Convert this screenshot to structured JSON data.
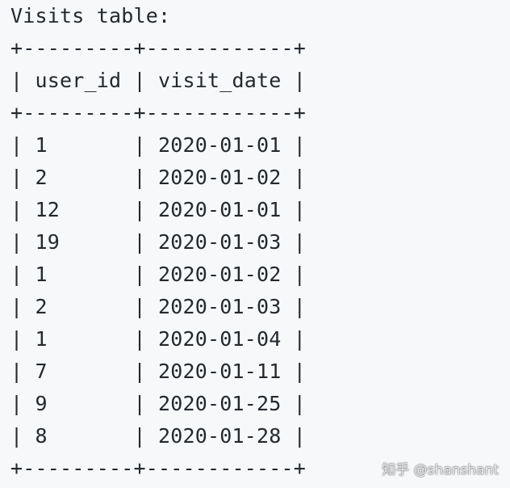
{
  "caption": "Visits table:",
  "table": {
    "border": "+---------+------------+",
    "header": "| user_id | visit_date |",
    "rows": [
      "| 1       | 2020-01-01 |",
      "| 2       | 2020-01-02 |",
      "| 12      | 2020-01-01 |",
      "| 19      | 2020-01-03 |",
      "| 1       | 2020-01-02 |",
      "| 2       | 2020-01-03 |",
      "| 1       | 2020-01-04 |",
      "| 7       | 2020-01-11 |",
      "| 9       | 2020-01-25 |",
      "| 8       | 2020-01-28 |"
    ]
  },
  "watermark": "知乎 @shanshant",
  "colors": {
    "background": "#f6f8fa",
    "text": "#24292e"
  }
}
